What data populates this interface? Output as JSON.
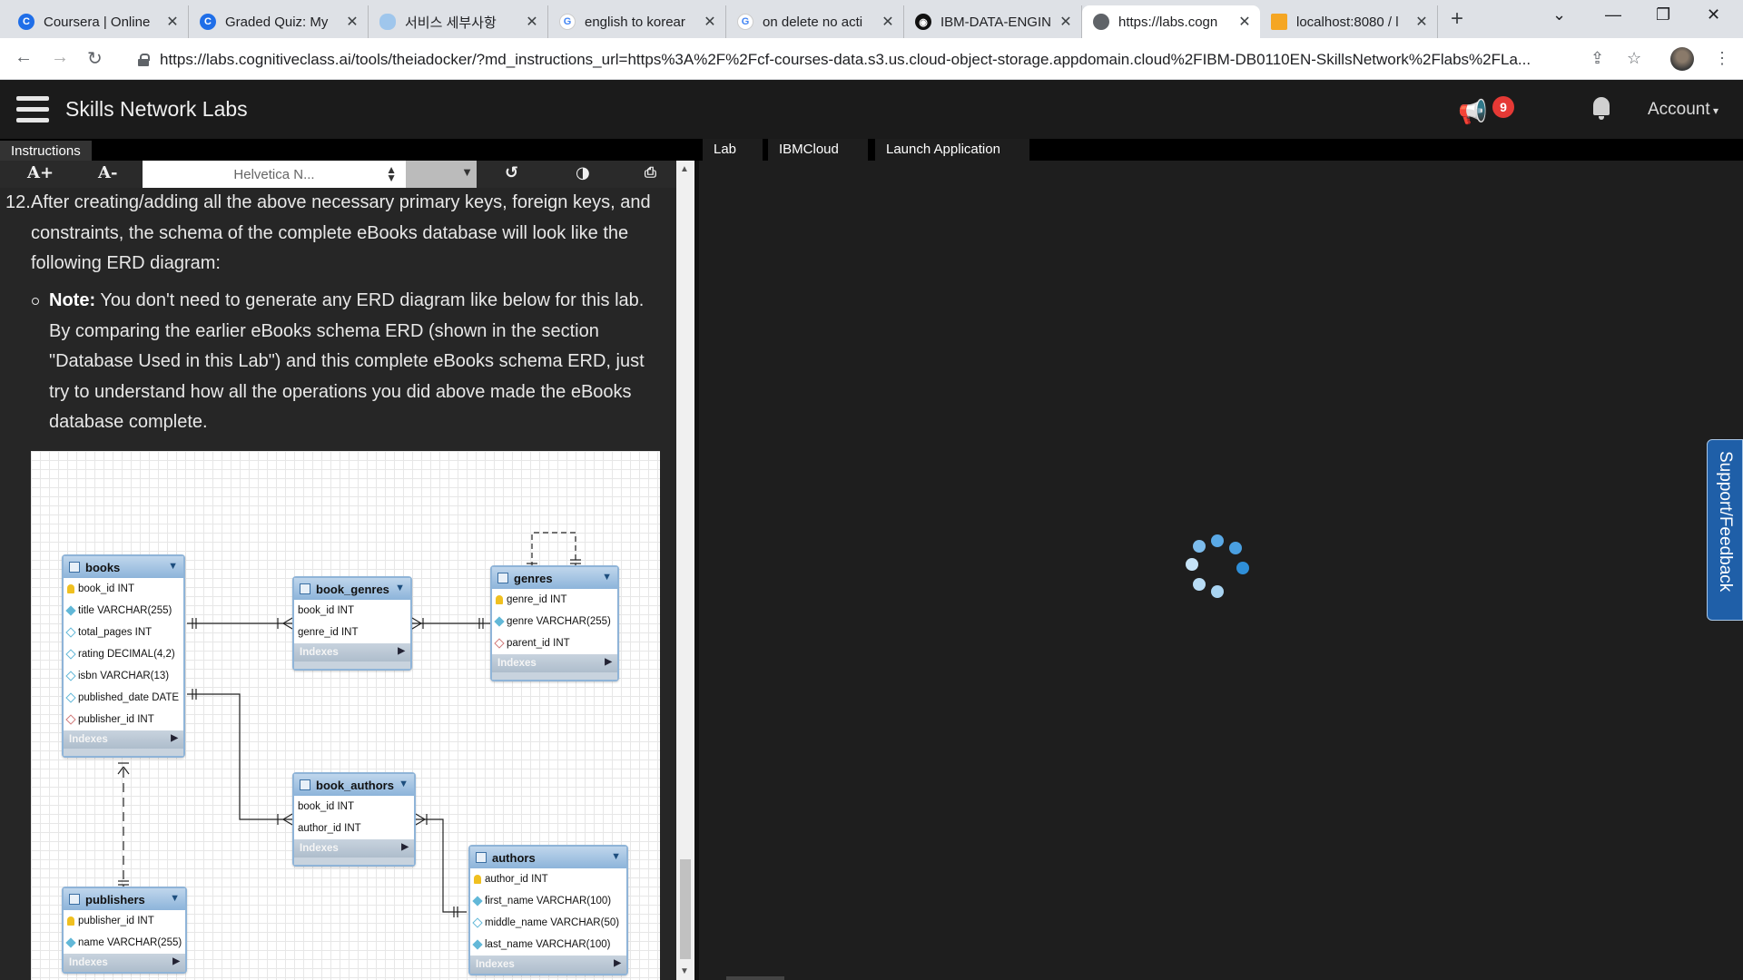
{
  "browser": {
    "tabs": [
      {
        "title": "Coursera | Online",
        "active": false
      },
      {
        "title": "Graded Quiz: My",
        "active": false
      },
      {
        "title": "서비스 세부사항",
        "active": false
      },
      {
        "title": "english to korear",
        "active": false
      },
      {
        "title": "on delete no acti",
        "active": false
      },
      {
        "title": "IBM-DATA-ENGIN",
        "active": false
      },
      {
        "title": "https://labs.cogn",
        "active": true
      },
      {
        "title": "localhost:8080 / l",
        "active": false
      }
    ],
    "url": "https://labs.cognitiveclass.ai/tools/theiadocker/?md_instructions_url=https%3A%2F%2Fcf-courses-data.s3.us.cloud-object-storage.appdomain.cloud%2FIBM-DB0110EN-SkillsNetwork%2Flabs%2FLa..."
  },
  "header": {
    "brand": "Skills Network Labs",
    "notification_count": "9",
    "account_label": "Account"
  },
  "left_panel": {
    "tab": "Instructions",
    "toolbar": {
      "increase_font": "A+",
      "decrease_font": "A-",
      "font_family": "Helvetica N..."
    },
    "step_number": "12.",
    "step_text": "After creating/adding all the above necessary primary keys, foreign keys, and constraints, the schema of the complete eBooks database will look like the following ERD diagram:",
    "note_label": "Note:",
    "note_text": "You don't need to generate any ERD diagram like below for this lab. By comparing the earlier eBooks schema ERD (shown in the section \"Database Used in this Lab\") and this complete eBooks schema ERD, just try to understand how all the operations you did above made the eBooks database complete."
  },
  "erd": {
    "indexes_label": "Indexes",
    "tables": {
      "books": {
        "name": "books",
        "columns": [
          {
            "text": "book_id INT",
            "key": "pk"
          },
          {
            "text": "title VARCHAR(255)",
            "key": "nn"
          },
          {
            "text": "total_pages INT",
            "key": "opt"
          },
          {
            "text": "rating DECIMAL(4,2)",
            "key": "opt"
          },
          {
            "text": "isbn VARCHAR(13)",
            "key": "opt"
          },
          {
            "text": "published_date DATE",
            "key": "opt"
          },
          {
            "text": "publisher_id INT",
            "key": "fk"
          }
        ]
      },
      "book_genres": {
        "name": "book_genres",
        "columns": [
          {
            "text": "book_id INT"
          },
          {
            "text": "genre_id INT"
          }
        ]
      },
      "genres": {
        "name": "genres",
        "columns": [
          {
            "text": "genre_id INT",
            "key": "pk"
          },
          {
            "text": "genre VARCHAR(255)",
            "key": "nn"
          },
          {
            "text": "parent_id INT",
            "key": "fk"
          }
        ]
      },
      "book_authors": {
        "name": "book_authors",
        "columns": [
          {
            "text": "book_id INT"
          },
          {
            "text": "author_id INT"
          }
        ]
      },
      "authors": {
        "name": "authors",
        "columns": [
          {
            "text": "author_id INT",
            "key": "pk"
          },
          {
            "text": "first_name VARCHAR(100)",
            "key": "nn"
          },
          {
            "text": "middle_name VARCHAR(50)",
            "key": "opt"
          },
          {
            "text": "last_name VARCHAR(100)",
            "key": "nn"
          }
        ]
      },
      "publishers": {
        "name": "publishers",
        "columns": [
          {
            "text": "publisher_id INT",
            "key": "pk"
          },
          {
            "text": "name VARCHAR(255)",
            "key": "nn"
          }
        ]
      }
    }
  },
  "right_panel": {
    "tabs": [
      "Lab",
      "IBMCloud",
      "Launch Application"
    ],
    "support_label": "Support/Feedback"
  }
}
